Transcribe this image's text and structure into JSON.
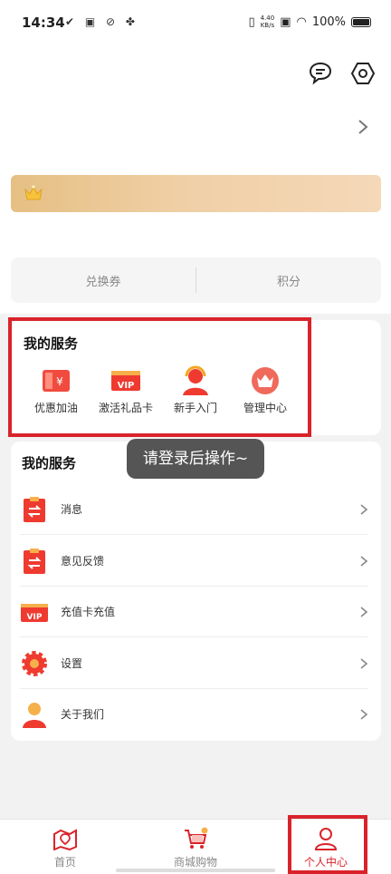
{
  "status_bar": {
    "time": "14:34",
    "net_speed_value": "4.40",
    "net_speed_unit": "KB/s",
    "battery": "100%"
  },
  "vip_service": {
    "title": "我的服务",
    "items": [
      {
        "label": "优惠加油",
        "icon": "fuel-coupon-icon"
      },
      {
        "label": "激活礼品卡",
        "icon": "vip-card-icon"
      },
      {
        "label": "新手入门",
        "icon": "headset-user-icon"
      },
      {
        "label": "管理中心",
        "icon": "crown-icon"
      }
    ]
  },
  "coupons": {
    "left": "兑换券",
    "right": "积分"
  },
  "services": {
    "title": "我的服务",
    "items": [
      {
        "label": "消息",
        "icon": "clipboard-exchange-icon"
      },
      {
        "label": "意见反馈",
        "icon": "clipboard-exchange-icon"
      },
      {
        "label": "充值卡充值",
        "icon": "vip-card-icon"
      },
      {
        "label": "设置",
        "icon": "gear-icon"
      },
      {
        "label": "关于我们",
        "icon": "user-icon"
      }
    ]
  },
  "toast": "请登录后操作~",
  "bottom_nav": [
    {
      "label": "首页",
      "icon": "map-home-icon",
      "active": false
    },
    {
      "label": "商城购物",
      "icon": "shopping-cart-icon",
      "active": false
    },
    {
      "label": "个人中心",
      "icon": "person-icon",
      "active": true
    }
  ],
  "colors": {
    "accent": "#d9232b",
    "vip_gold": "#e5bf83",
    "toast_bg": "#555555"
  }
}
